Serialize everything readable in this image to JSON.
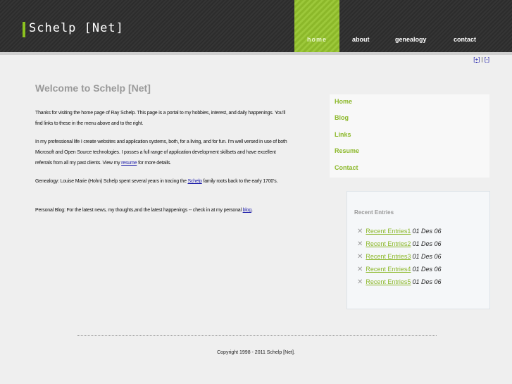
{
  "header": {
    "logo_text": "Schelp [Net]",
    "nav": [
      "home",
      "about",
      "genealogy",
      "contact"
    ]
  },
  "resize_controls": {
    "larger": "[+]",
    "separator": "|",
    "smaller": "[-]"
  },
  "main": {
    "title": "Welcome to Schelp [Net]",
    "para1": "Thanks for visiting the home page of Ray Schelp. This page is a portal to my hobbies, interest, and daily happenings. You'll find links to these in the menu above and to the right.",
    "para2_pre": "In my professional life I create websites and application systems, both, for a living, and for fun. I'm well versed in use of both Microsoft and Open Source technologies. I posses a full range of application development skillsets and have excellent referrals from all my past clients. View my ",
    "para2_link": "resume",
    "para2_post": " for more details.",
    "para3_pre": "Genealogy: Louise Marie (Hohn) Schelp spent several years in tracing the ",
    "para3_link": "Schelp",
    "para3_post": " family roots back to the early 1700's.",
    "para4_pre": "Personal Blog: For the latest news, my thoughts,and the latest happenings -- check in at my personal ",
    "para4_link": "blog",
    "para4_post": "."
  },
  "side_menu": [
    "Home",
    "Blog",
    "Links",
    "Resume",
    "Contact"
  ],
  "recent": {
    "title": "Recent Entries",
    "entries": [
      {
        "label": "Recent Entries1",
        "date": "01 Des 06"
      },
      {
        "label": "Recent Entries2",
        "date": "01 Des 06"
      },
      {
        "label": "Recent Entries3",
        "date": "01 Des 06"
      },
      {
        "label": "Recent Entries4",
        "date": "01 Des 06"
      },
      {
        "label": "Recent Entries5",
        "date": "01 Des 06"
      }
    ]
  },
  "footer": {
    "copyright": "Copyright 1998 - 2011 Schelp [Net]."
  },
  "colors": {
    "accent": "#8cb82a",
    "header_bg": "#2f2f2f",
    "link": "#1a1aa8"
  }
}
